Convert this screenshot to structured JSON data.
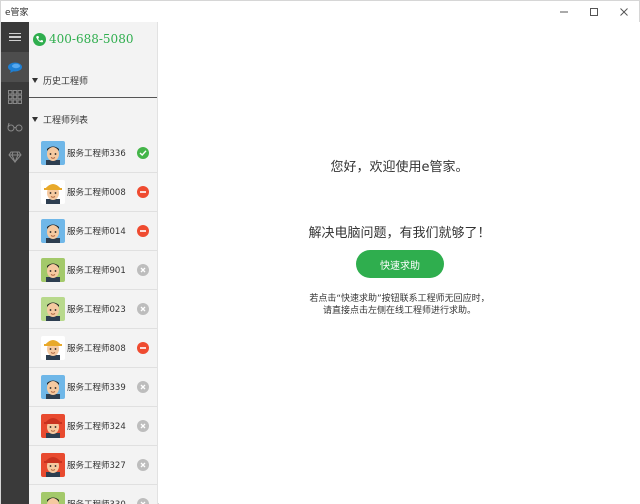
{
  "window": {
    "title": "e管家",
    "controls": [
      "minimize-icon",
      "maximize-icon",
      "close-icon"
    ]
  },
  "rail": {
    "items": [
      "menu-icon",
      "chat-icon",
      "grid-icon",
      "glasses-icon",
      "diamond-icon"
    ]
  },
  "panel": {
    "hotline": "400-688-5080",
    "history_label": "历史工程师",
    "list_label": "工程师列表",
    "engineers": [
      {
        "name": "服务工程师336",
        "status": "online"
      },
      {
        "name": "服务工程师008",
        "status": "busy"
      },
      {
        "name": "服务工程师014",
        "status": "busy"
      },
      {
        "name": "服务工程师901",
        "status": "offline"
      },
      {
        "name": "服务工程师023",
        "status": "offline"
      },
      {
        "name": "服务工程师808",
        "status": "busy"
      },
      {
        "name": "服务工程师339",
        "status": "offline"
      },
      {
        "name": "服务工程师324",
        "status": "offline"
      },
      {
        "name": "服务工程师327",
        "status": "offline"
      },
      {
        "name": "服务工程师330",
        "status": "offline"
      }
    ]
  },
  "main": {
    "welcome": "您好，欢迎使用e管家。",
    "tagline": "解决电脑问题，有我们就够了！",
    "help_button": "快速求助",
    "hint_line1": "若点击“快速求助”按钮联系工程师无回应时，",
    "hint_line2": "请直接点击左侧在线工程师进行求助。"
  },
  "colors": {
    "accent": "#2fae4e",
    "rail": "#3a3a3a",
    "active_rail": "#1e7fd3",
    "busy": "#ef4b30",
    "offline": "#bdbdbd"
  }
}
